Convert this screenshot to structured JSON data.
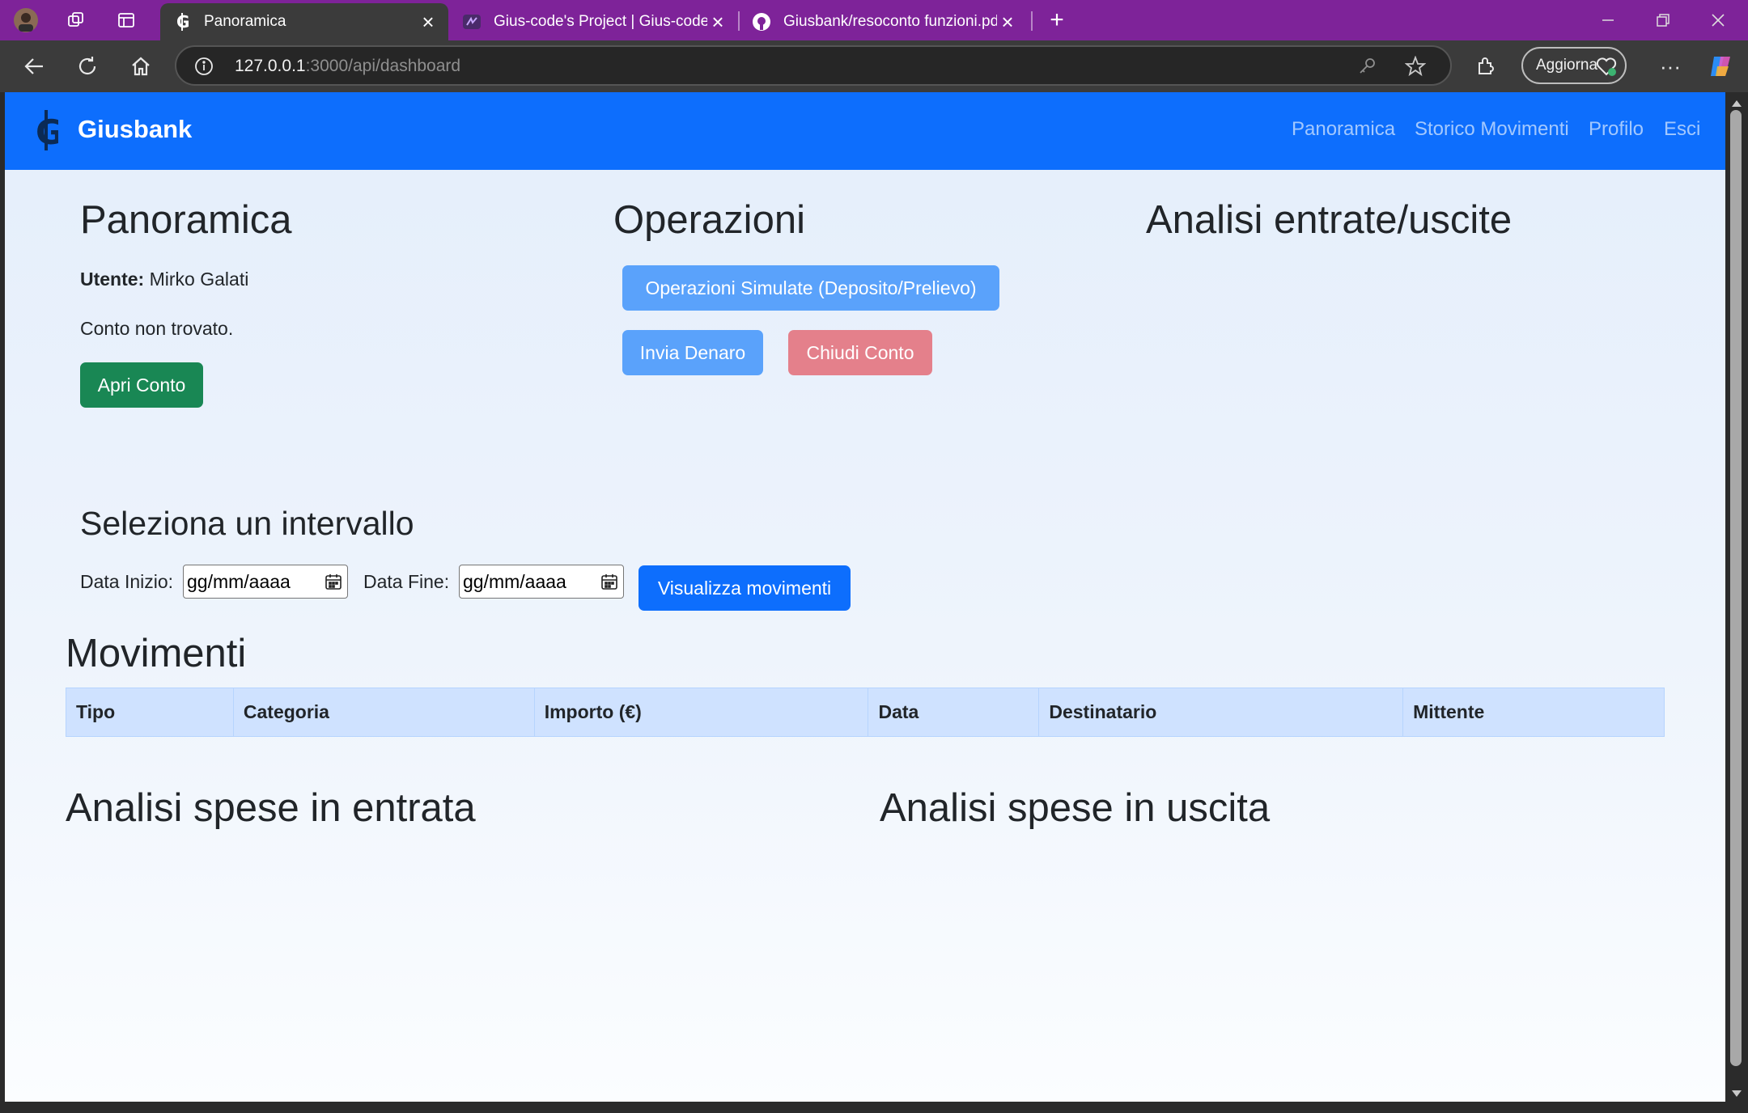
{
  "browser": {
    "tabs": [
      {
        "title": "Panoramica",
        "active": true
      },
      {
        "title": "Gius-code's Project | Gius-code's ...",
        "active": false
      },
      {
        "title": "Giusbank/resoconto funzioni.pdf",
        "active": false
      }
    ],
    "url_host": "127.0.0.1",
    "url_rest": ":3000/api/dashboard",
    "update_label": "Aggiorna"
  },
  "site": {
    "brand": "Giusbank",
    "nav": [
      "Panoramica",
      "Storico Movimenti",
      "Profilo",
      "Esci"
    ],
    "colors": {
      "primary": "#0d6efd",
      "success": "#198754",
      "danger_light": "#e4808b",
      "primary_light": "#5aa2fb"
    }
  },
  "overview": {
    "title": "Panoramica",
    "user_label": "Utente:",
    "user_name": "Mirko Galati",
    "account_status": "Conto non trovato.",
    "open_account_btn": "Apri Conto"
  },
  "operations": {
    "title": "Operazioni",
    "simulated_btn": "Operazioni Simulate (Deposito/Prelievo)",
    "send_btn": "Invia Denaro",
    "close_btn": "Chiudi Conto"
  },
  "analysis": {
    "title": "Analisi entrate/uscite",
    "income_title": "Analisi spese in entrata",
    "expense_title": "Analisi spese in uscita"
  },
  "interval": {
    "title": "Seleziona un intervallo",
    "start_label": "Data Inizio:",
    "start_value": "gg/mm/aaaa",
    "end_label": "Data Fine:",
    "end_value": "gg/mm/aaaa",
    "view_btn": "Visualizza movimenti"
  },
  "movements": {
    "title": "Movimenti",
    "columns": [
      "Tipo",
      "Categoria",
      "Importo (€)",
      "Data",
      "Destinatario",
      "Mittente"
    ]
  }
}
